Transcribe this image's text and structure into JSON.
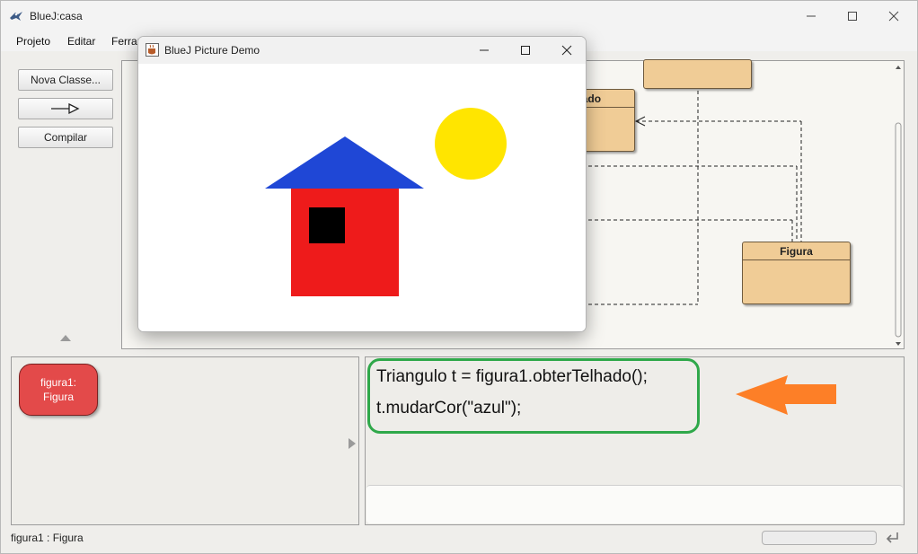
{
  "window": {
    "title": "BlueJ:casa"
  },
  "menu": {
    "items": [
      "Projeto",
      "Editar",
      "Ferramentas"
    ]
  },
  "toolbar": {
    "new_class": "Nova Classe...",
    "compile": "Compilar"
  },
  "diagram": {
    "classes": [
      {
        "name": ""
      },
      {
        "name": "Telhado"
      },
      {
        "name": "Figura"
      }
    ]
  },
  "objectbench": {
    "object": {
      "name": "figura1:",
      "type": "Figura"
    }
  },
  "codepad": {
    "lines": [
      "Triangulo t = figura1.obterTelhado();",
      "t.mudarCor(\"azul\");"
    ]
  },
  "status": {
    "text": "figura1 : Figura"
  },
  "picture_window": {
    "title": "BlueJ Picture Demo"
  },
  "colors": {
    "roof": "#1f47d6",
    "wall": "#ee1b1b",
    "window": "#000000",
    "sun": "#ffe500",
    "highlight": "#2fa84a",
    "arrow": "#fd7f27"
  }
}
